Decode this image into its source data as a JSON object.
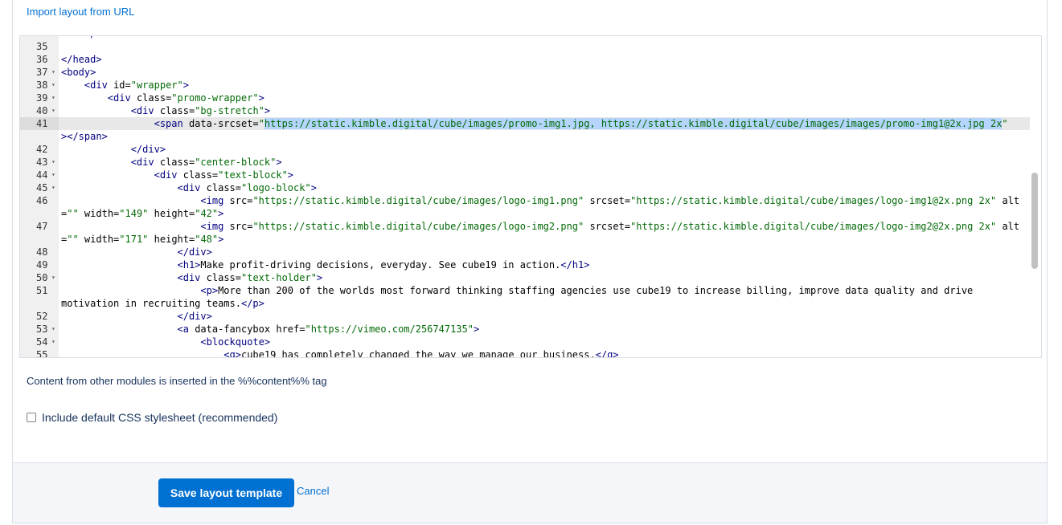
{
  "import_link": "Import layout from URL",
  "editor": {
    "lines": [
      {
        "num": "",
        "fold": false,
        "html": "<span class=\"t\">    </span><span class=\"t\">&lt;/</span>"
      },
      {
        "num": "35",
        "fold": false,
        "html": ""
      },
      {
        "num": "36",
        "fold": false,
        "html": "<span class=\"t\">&lt;/head&gt;</span>"
      },
      {
        "num": "37",
        "fold": true,
        "html": "<span class=\"t\">&lt;body&gt;</span>"
      },
      {
        "num": "38",
        "fold": true,
        "html": "    <span class=\"t\">&lt;div</span> <span class=\"a\">id=</span><span class=\"s\">\"wrapper\"</span><span class=\"t\">&gt;</span>"
      },
      {
        "num": "39",
        "fold": true,
        "html": "        <span class=\"t\">&lt;div</span> <span class=\"a\">class=</span><span class=\"s\">\"promo-wrapper\"</span><span class=\"t\">&gt;</span>"
      },
      {
        "num": "40",
        "fold": true,
        "html": "            <span class=\"t\">&lt;div</span> <span class=\"a\">class=</span><span class=\"s\">\"bg-stretch\"</span><span class=\"t\">&gt;</span>"
      },
      {
        "num": "41",
        "fold": false,
        "active": true,
        "html": "                <span class=\"t\">&lt;span</span> <span class=\"a\">data-srcset=</span><span class=\"s\">\"<span class=\"sel\">https://static.kimble.digital/cube/images/promo-img1.jpg, https://static.kimble.digital/cube/images/images/promo-img1@2x.jpg 2x</span>\"</span>"
      },
      {
        "num": "",
        "fold": false,
        "html": "<span class=\"t\">&gt;&lt;/span&gt;</span>"
      },
      {
        "num": "42",
        "fold": false,
        "html": "            <span class=\"t\">&lt;/div&gt;</span>"
      },
      {
        "num": "43",
        "fold": true,
        "html": "            <span class=\"t\">&lt;div</span> <span class=\"a\">class=</span><span class=\"s\">\"center-block\"</span><span class=\"t\">&gt;</span>"
      },
      {
        "num": "44",
        "fold": true,
        "html": "                <span class=\"t\">&lt;div</span> <span class=\"a\">class=</span><span class=\"s\">\"text-block\"</span><span class=\"t\">&gt;</span>"
      },
      {
        "num": "45",
        "fold": true,
        "html": "                    <span class=\"t\">&lt;div</span> <span class=\"a\">class=</span><span class=\"s\">\"logo-block\"</span><span class=\"t\">&gt;</span>"
      },
      {
        "num": "46",
        "fold": false,
        "html": "                        <span class=\"t\">&lt;img</span> <span class=\"a\">src=</span><span class=\"s\">\"https://static.kimble.digital/cube/images/logo-img1.png\"</span> <span class=\"a\">srcset=</span><span class=\"s\">\"https://static.kimble.digital/cube/images/logo-img1@2x.png 2x\"</span> <span class=\"a\">alt</span>"
      },
      {
        "num": "",
        "fold": false,
        "html": "<span class=\"a\">=</span><span class=\"s\">\"\"</span> <span class=\"a\">width=</span><span class=\"s\">\"149\"</span> <span class=\"a\">height=</span><span class=\"s\">\"42\"</span><span class=\"t\">&gt;</span>"
      },
      {
        "num": "47",
        "fold": false,
        "html": "                        <span class=\"t\">&lt;img</span> <span class=\"a\">src=</span><span class=\"s\">\"https://static.kimble.digital/cube/images/logo-img2.png\"</span> <span class=\"a\">srcset=</span><span class=\"s\">\"https://static.kimble.digital/cube/images/logo-img2@2x.png 2x\"</span> <span class=\"a\">alt</span>"
      },
      {
        "num": "",
        "fold": false,
        "html": "<span class=\"a\">=</span><span class=\"s\">\"\"</span> <span class=\"a\">width=</span><span class=\"s\">\"171\"</span> <span class=\"a\">height=</span><span class=\"s\">\"48\"</span><span class=\"t\">&gt;</span>"
      },
      {
        "num": "48",
        "fold": false,
        "html": "                    <span class=\"t\">&lt;/div&gt;</span>"
      },
      {
        "num": "49",
        "fold": false,
        "html": "                    <span class=\"t\">&lt;h1&gt;</span>Make profit-driving decisions, everyday. See cube19 in action.<span class=\"t\">&lt;/h1&gt;</span>"
      },
      {
        "num": "50",
        "fold": true,
        "html": "                    <span class=\"t\">&lt;div</span> <span class=\"a\">class=</span><span class=\"s\">\"text-holder\"</span><span class=\"t\">&gt;</span>"
      },
      {
        "num": "51",
        "fold": false,
        "html": "                        <span class=\"t\">&lt;p&gt;</span>More than 200 of the worlds most forward thinking staffing agencies use cube19 to increase billing, improve data quality and drive"
      },
      {
        "num": "",
        "fold": false,
        "html": "motivation in recruiting teams.<span class=\"t\">&lt;/p&gt;</span>"
      },
      {
        "num": "52",
        "fold": false,
        "html": "                    <span class=\"t\">&lt;/div&gt;</span>"
      },
      {
        "num": "53",
        "fold": true,
        "html": "                    <span class=\"t\">&lt;a</span> <span class=\"a\">data-fancybox</span> <span class=\"a\">href=</span><span class=\"s\">\"https://vimeo.com/256747135\"</span><span class=\"t\">&gt;</span>"
      },
      {
        "num": "54",
        "fold": true,
        "html": "                        <span class=\"t\">&lt;blockquote&gt;</span>"
      },
      {
        "num": "55",
        "fold": false,
        "html": "                            <span class=\"t\">&lt;q&gt;</span>cube19 has completely changed the way we manage our business.<span class=\"t\">&lt;/q&gt;</span>"
      }
    ]
  },
  "info_text": "Content from other modules is inserted in the %%content%% tag",
  "checkbox_label": "Include default CSS stylesheet (recommended)",
  "save_button": "Save layout template",
  "cancel_link": "Cancel"
}
